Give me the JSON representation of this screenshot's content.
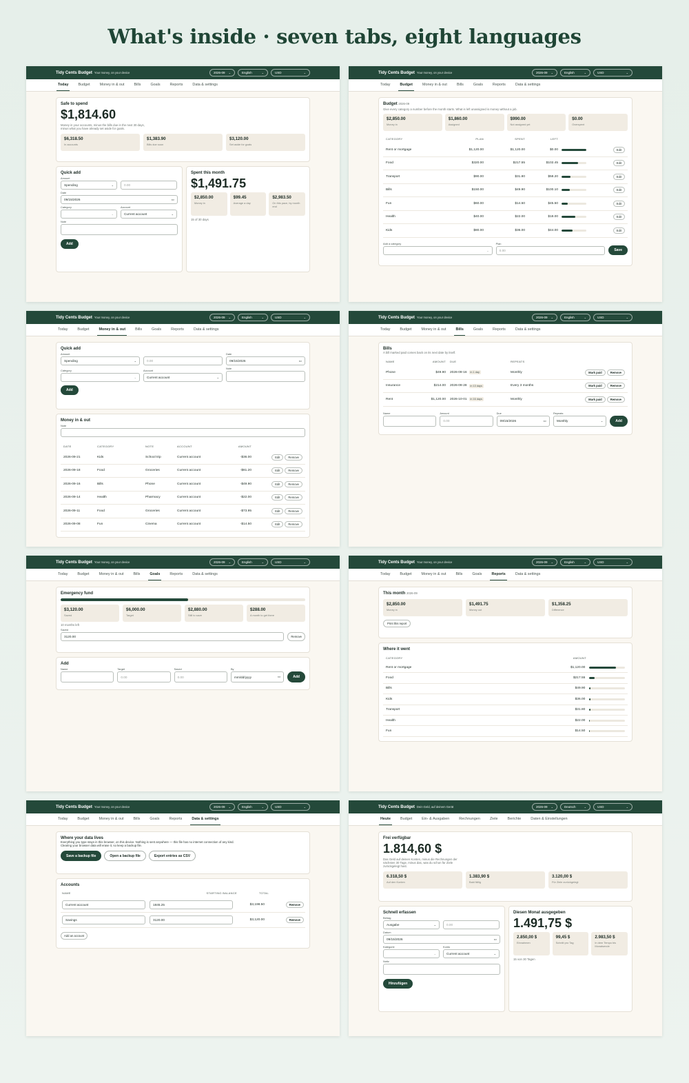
{
  "headline": "What's inside · seven tabs, eight languages",
  "en": {
    "brand": "Tidy Cents Budget",
    "tagline": "Your money, on your device",
    "month": "2026-09",
    "lang": "English",
    "currency": "USD",
    "tabs": [
      "Today",
      "Budget",
      "Money in & out",
      "Bills",
      "Goals",
      "Reports",
      "Data & settings"
    ]
  },
  "de": {
    "brand": "Tidy Cents Budget",
    "tagline": "Dein Geld, auf deinem Gerät",
    "month": "2026-09",
    "lang": "Deutsch",
    "currency": "USD",
    "tabs": [
      "Heute",
      "Budget",
      "Ein- & Ausgaben",
      "Rechnungen",
      "Ziele",
      "Berichte",
      "Daten & Einstellungen"
    ]
  },
  "today": {
    "safe_title": "Safe to spend",
    "safe_amount": "$1,814.60",
    "safe_desc1": "Money in your accounts, minus the bills due in the next 30 days,",
    "safe_desc2": "minus what you have already set aside for goals.",
    "tiles": [
      {
        "v": "$6,318.50",
        "l": "In accounts"
      },
      {
        "v": "$1,383.90",
        "l": "Bills due soon"
      },
      {
        "v": "$3,120.00",
        "l": "Set aside for goals"
      }
    ],
    "qa_title": "Quick add",
    "amount_label": "Amount",
    "type_value": "Spending",
    "amount_placeholder": "0.00",
    "date_label": "Date",
    "date_value": "09/15/2026",
    "category_label": "Category",
    "account_label": "Account",
    "account_value": "Current account",
    "note_label": "Note",
    "add_label": "Add",
    "spent_title": "Spent this month",
    "spent_amount": "$1,491.75",
    "spent_tiles": [
      {
        "v": "$2,850.00",
        "l": "Money in"
      },
      {
        "v": "$99.45",
        "l": "Average a day"
      },
      {
        "v": "$2,983.50",
        "l": "On this pace, by month end"
      }
    ],
    "days_note": "15 of 30 days"
  },
  "budget": {
    "title": "Budget",
    "month": "2026-09",
    "desc": "Give every category a number before the month starts. What is left unassigned is money without a job.",
    "tiles": [
      {
        "v": "$2,850.00",
        "l": "Money in"
      },
      {
        "v": "$1,860.00",
        "l": "Assigned"
      },
      {
        "v": "$990.00",
        "l": "Not assigned yet"
      },
      {
        "v": "$0.00",
        "l": "Overspent"
      }
    ],
    "headers": [
      "CATEGORY",
      "PLAN",
      "SPENT",
      "LEFT"
    ],
    "rows": [
      {
        "c": "Rent or mortgage",
        "p": "$1,120.00",
        "s": "$1,120.00",
        "l": "$0.00",
        "pct": 1.0
      },
      {
        "c": "Food",
        "p": "$320.00",
        "s": "$217.55",
        "l": "$102.45",
        "pct": 0.68
      },
      {
        "c": "Transport",
        "p": "$90.00",
        "s": "$31.80",
        "l": "$58.20",
        "pct": 0.35
      },
      {
        "c": "Bills",
        "p": "$150.00",
        "s": "$49.90",
        "l": "$100.10",
        "pct": 0.33
      },
      {
        "c": "Fun",
        "p": "$60.00",
        "s": "$14.50",
        "l": "$45.50",
        "pct": 0.24
      },
      {
        "c": "Health",
        "p": "$40.00",
        "s": "$22.00",
        "l": "$18.00",
        "pct": 0.55
      },
      {
        "c": "Kids",
        "p": "$80.00",
        "s": "$36.00",
        "l": "$44.00",
        "pct": 0.45
      }
    ],
    "edit": "Edit",
    "add_cat_label": "Add a category",
    "plan_label": "Plan",
    "plan_placeholder": "0.00",
    "save": "Save"
  },
  "money": {
    "qa_title": "Quick add",
    "amount_label": "Amount",
    "type_value": "Spending",
    "amount_placeholder": "0.00",
    "date_label": "Date",
    "date_value": "09/15/2026",
    "category_label": "Category",
    "account_label": "Account",
    "account_value": "Current account",
    "note_label": "Note",
    "add": "Add",
    "list_title": "Money in & out",
    "filter_label": "Note",
    "headers": [
      "DATE",
      "CATEGORY",
      "NOTE",
      "ACCOUNT",
      "AMOUNT"
    ],
    "rows": [
      {
        "d": "2026-09-21",
        "c": "Kids",
        "n": "School trip",
        "a": "Current account",
        "v": "-$36.00"
      },
      {
        "d": "2026-09-18",
        "c": "Food",
        "n": "Groceries",
        "a": "Current account",
        "v": "-$81.20"
      },
      {
        "d": "2026-09-16",
        "c": "Bills",
        "n": "Phone",
        "a": "Current account",
        "v": "-$49.90"
      },
      {
        "d": "2026-09-14",
        "c": "Health",
        "n": "Pharmacy",
        "a": "Current account",
        "v": "-$22.00"
      },
      {
        "d": "2026-09-11",
        "c": "Food",
        "n": "Groceries",
        "a": "Current account",
        "v": "-$73.95"
      },
      {
        "d": "2026-09-08",
        "c": "Fun",
        "n": "Cinema",
        "a": "Current account",
        "v": "-$14.50"
      }
    ],
    "edit": "Edit",
    "remove": "Remove"
  },
  "bills": {
    "title": "Bills",
    "desc": "A bill marked paid comes back on its next date by itself.",
    "headers": [
      "NAME",
      "AMOUNT",
      "DUE",
      "REPEATS"
    ],
    "rows": [
      {
        "n": "Phone",
        "a": "$49.90",
        "d": "2026-09-16",
        "chip": "in 1 day",
        "r": "Monthly"
      },
      {
        "n": "Insurance",
        "a": "$214.00",
        "d": "2026-09-28",
        "chip": "in 13 days",
        "r": "Every 3 months"
      },
      {
        "n": "Rent",
        "a": "$1,120.00",
        "d": "2026-10-01",
        "chip": "in 16 days",
        "r": "Monthly"
      }
    ],
    "mark_paid": "Mark paid",
    "remove": "Remove",
    "name_label": "Name",
    "amount_label": "Amount",
    "amount_placeholder": "0.00",
    "due_label": "Due",
    "due_value": "09/15/2026",
    "repeats_label": "Repeats",
    "repeats_value": "Monthly",
    "add": "Add"
  },
  "goals": {
    "title": "Emergency fund",
    "progress": 0.52,
    "tiles": [
      {
        "v": "$3,120.00",
        "l": "Saved"
      },
      {
        "v": "$6,000.00",
        "l": "Target"
      },
      {
        "v": "$2,880.00",
        "l": "Still to save"
      },
      {
        "v": "$288.00",
        "l": "A month to get there"
      }
    ],
    "months_note": "10 months left",
    "saved_label": "Saved",
    "saved_value": "3120.00",
    "remove": "Remove",
    "add_title": "Add",
    "name_label": "Name",
    "target_label": "Target",
    "target_placeholder": "0.00",
    "saved2_label": "Saved",
    "saved2_placeholder": "0.00",
    "by_label": "By",
    "by_placeholder": "mm/dd/yyyy",
    "add": "Add"
  },
  "reports": {
    "title": "This month",
    "month": "2026-09",
    "tiles": [
      {
        "v": "$2,850.00",
        "l": "Money in"
      },
      {
        "v": "$1,491.75",
        "l": "Money out"
      },
      {
        "v": "$1,358.25",
        "l": "Difference"
      }
    ],
    "print": "Print this report",
    "where_title": "Where it went",
    "headers": [
      "CATEGORY",
      "AMOUNT"
    ],
    "rows": [
      {
        "c": "Rent or mortgage",
        "v": "$1,120.00",
        "pct": 0.75
      },
      {
        "c": "Food",
        "v": "$217.55",
        "pct": 0.15
      },
      {
        "c": "Bills",
        "v": "$49.90",
        "pct": 0.04
      },
      {
        "c": "Kids",
        "v": "$36.00",
        "pct": 0.03
      },
      {
        "c": "Transport",
        "v": "$31.80",
        "pct": 0.025
      },
      {
        "c": "Health",
        "v": "$22.00",
        "pct": 0.017
      },
      {
        "c": "Fun",
        "v": "$14.50",
        "pct": 0.011
      }
    ]
  },
  "data": {
    "title": "Where your data lives",
    "desc1": "Everything you type stays in this browser, on this device. Nothing is sent anywhere — this file has no internet connection of any kind.",
    "desc2": "Clearing your browser data will erase it, so keep a backup file.",
    "save_backup": "Save a backup file",
    "open_backup": "Open a backup file",
    "export_csv": "Export entries as CSV",
    "accounts_title": "Accounts",
    "headers": [
      "NAME",
      "STARTING BALANCE",
      "TOTAL"
    ],
    "rows": [
      {
        "n": "Current account",
        "b": "1845.25",
        "t": "$3,198.50"
      },
      {
        "n": "Savings",
        "b": "3120.00",
        "t": "$3,120.00"
      }
    ],
    "remove": "Remove",
    "add_account": "Add an account"
  },
  "de_today": {
    "safe_title": "Frei verfügbar",
    "safe_amount": "1.814,60 $",
    "safe_desc1": "Das Geld auf deinen Konten, minus die Rechnungen der",
    "safe_desc2": "nächsten 30 Tage, minus das, was du schon für Ziele",
    "safe_desc3": "zurückgelegt hast.",
    "tiles": [
      {
        "v": "6.318,50 $",
        "l": "Auf den Konten"
      },
      {
        "v": "1.383,90 $",
        "l": "Bald fällig"
      },
      {
        "v": "3.120,00 $",
        "l": "Für Ziele zurückgelegt"
      }
    ],
    "qa_title": "Schnell erfassen",
    "amount_label": "Betrag",
    "type_value": "Ausgabe",
    "amount_placeholder": "0.00",
    "date_label": "Datum",
    "date_value": "09/15/2026",
    "category_label": "Kategorie",
    "account_label": "Konto",
    "account_value": "Current account",
    "note_label": "Notiz",
    "add_label": "Hinzufügen",
    "spent_title": "Diesen Monat ausgegeben",
    "spent_amount": "1.491,75 $",
    "spent_tiles": [
      {
        "v": "2.850,00 $",
        "l": "Einnahmen"
      },
      {
        "v": "99,45 $",
        "l": "Schnitt pro Tag"
      },
      {
        "v": "2.983,50 $",
        "l": "In dem Tempo bis Monatsende"
      }
    ],
    "days_note": "15 von 30 Tagen"
  }
}
